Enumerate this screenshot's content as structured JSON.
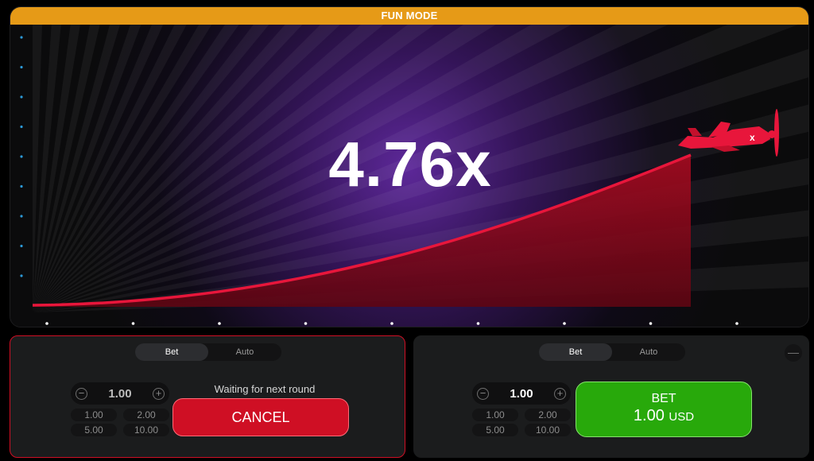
{
  "banner": "FUN MODE",
  "multiplier": "4.76x",
  "colors": {
    "banner": "#e69a17",
    "curve": "#e8163b",
    "cancel": "#cf0f24",
    "bet": "#28a90b"
  },
  "plane_icon": "red-propeller-plane-icon",
  "left_panel": {
    "tabs": [
      "Bet",
      "Auto"
    ],
    "active_tab": "Bet",
    "amount": "1.00",
    "quick": [
      "1.00",
      "2.00",
      "5.00",
      "10.00"
    ],
    "status": "Waiting for next round",
    "action": "CANCEL"
  },
  "right_panel": {
    "tabs": [
      "Bet",
      "Auto"
    ],
    "active_tab": "Bet",
    "amount": "1.00",
    "quick": [
      "1.00",
      "2.00",
      "5.00",
      "10.00"
    ],
    "bet_label": "BET",
    "bet_amount": "1.00",
    "bet_currency": "USD",
    "remove_label": "—"
  }
}
